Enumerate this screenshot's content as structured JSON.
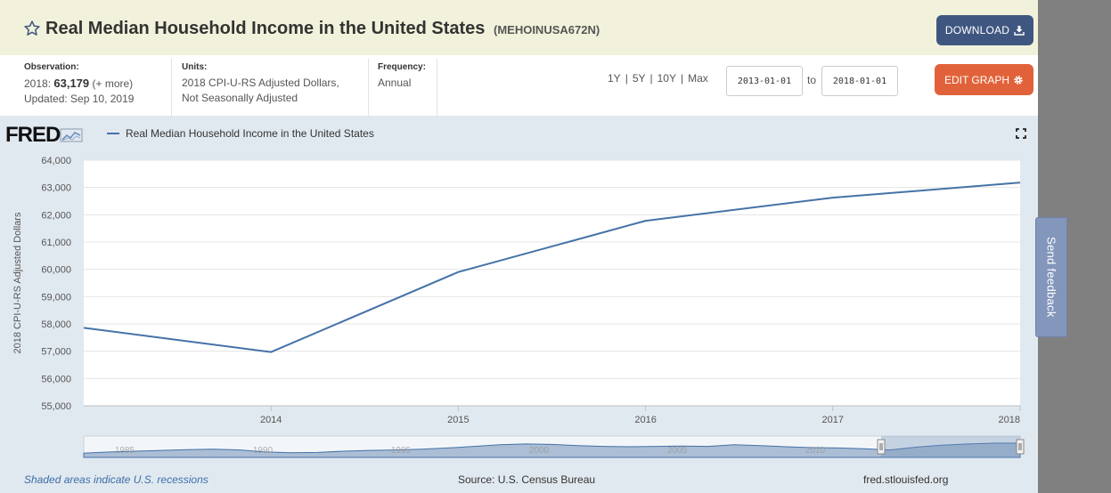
{
  "header": {
    "title": "Real Median Household Income in the United States",
    "series_id": "(MEHOINUSA672N)",
    "download_label": "DOWNLOAD"
  },
  "meta": {
    "observation_label": "Observation:",
    "observation_year": "2018:",
    "observation_value": "63,179",
    "observation_more": "(+ more)",
    "updated": "Updated: Sep 10, 2019",
    "units_label": "Units:",
    "units_line1": "2018 CPI-U-RS Adjusted Dollars,",
    "units_line2": "Not Seasonally Adjusted",
    "frequency_label": "Frequency:",
    "frequency_value": "Annual"
  },
  "range": {
    "links": [
      "1Y",
      "5Y",
      "10Y",
      "Max"
    ],
    "separator": "|",
    "start_date": "2013-01-01",
    "to_label": "to",
    "end_date": "2018-01-01",
    "edit_label": "EDIT GRAPH"
  },
  "chart": {
    "logo": "FRED",
    "legend": "Real Median Household Income in the United States",
    "feedback": "Send feedback",
    "recession_note": "Shaded areas indicate U.S. recessions",
    "source": "Source: U.S. Census Bureau",
    "site": "fred.stlouisfed.org"
  },
  "colors": {
    "line": "#4572a7",
    "download_button": "#3f5780",
    "edit_button": "#e1623a",
    "header_bg": "#f2f2dc",
    "panel_bg": "#e1e9f0"
  },
  "chart_data": {
    "type": "line",
    "x": [
      2013,
      2014,
      2015,
      2016,
      2017,
      2018
    ],
    "series": [
      {
        "name": "Real Median Household Income in the United States",
        "values": [
          57856,
          56969,
          59901,
          61779,
          62626,
          63179
        ]
      }
    ],
    "xlim": [
      2013,
      2018
    ],
    "x_ticks": [
      "2014",
      "2015",
      "2016",
      "2017",
      "2018"
    ],
    "ylim": [
      55000,
      64000
    ],
    "y_ticks": [
      "55,000",
      "56,000",
      "57,000",
      "58,000",
      "59,000",
      "60,000",
      "61,000",
      "62,000",
      "63,000",
      "64,000"
    ],
    "ylabel": "2018 CPI-U-RS Adjusted Dollars",
    "navigator_ticks": [
      "1985",
      "1990",
      "1995",
      "2000",
      "2005",
      "2010"
    ],
    "grid": true
  }
}
